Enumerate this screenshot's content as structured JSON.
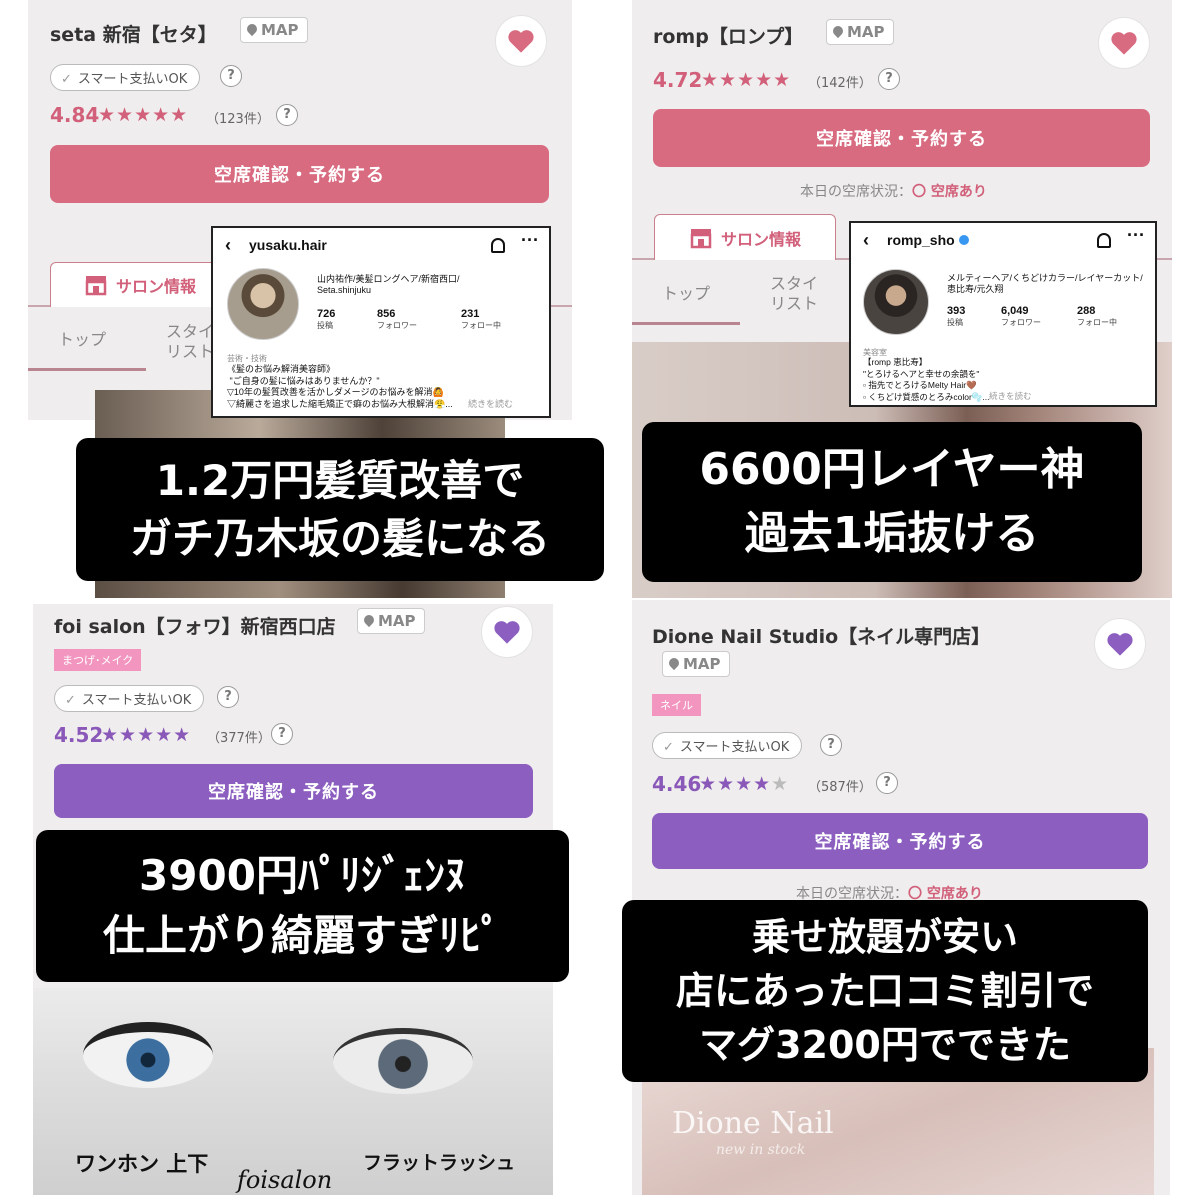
{
  "panels": [
    {
      "salon_name": "seta 新宿【セタ】",
      "map_label": "MAP",
      "payment_badge": "スマート支払いOK",
      "rating": "4.84",
      "stars": "★★★★★",
      "review_count": "（123件）",
      "help": "?",
      "book_button": "空席確認・予約する",
      "tab_active": "サロン情報",
      "tab_top": "トップ",
      "tab_style": "スタイ\nリスト",
      "instagram": {
        "handle": "yusaku.hair",
        "bio_head": "山内祐作/美髪ロングヘア/新宿西口/\nSeta.shinjuku",
        "posts": "726",
        "posts_label": "投稿",
        "followers": "856",
        "followers_label": "フォロワー",
        "following": "231",
        "following_label": "フォロー中",
        "category": "芸術・技術",
        "bio": "《髪のお悩み解消美容師》\n \"ご自身の髪に悩みはありませんか？\"\n▽10年の髪質改善を活かしダメージのお悩みを解消🙆\n▽綺麗さを追求した縮毛矯正で癖のお悩み大根解消😤...",
        "more": "続きを読む"
      },
      "caption_line1": "1.2万円髪質改善で",
      "caption_line2": "ガチ乃木坂の髪になる"
    },
    {
      "salon_name": "romp【ロンプ】",
      "map_label": "MAP",
      "rating": "4.72",
      "stars": "★★★★★",
      "review_count": "（142件）",
      "help": "?",
      "book_button": "空席確認・予約する",
      "status_label": "本日の空席状況：",
      "status_value": "〇 空席あり",
      "tab_active": "サロン情報",
      "tab_top": "トップ",
      "tab_style": "スタイ\nリスト",
      "instagram": {
        "handle": "romp_sho",
        "bio_head": "メルティーヘア/くちどけカラー/レイヤーカット/\n恵比寿/元久翔",
        "posts": "393",
        "posts_label": "投稿",
        "followers": "6,049",
        "followers_label": "フォロワー",
        "following": "288",
        "following_label": "フォロー中",
        "category": "美容室",
        "bio": "【romp 恵比寿】\n\"とろけるヘアと幸せの余韻を\"\n▫ 指先でとろけるMelty Hair🤎\n▫ くちどけ質感のとろみcolor🫧...",
        "more": "続きを読む"
      },
      "caption_line1": "6600円レイヤー神",
      "caption_line2": "過去1垢抜ける"
    },
    {
      "salon_name": "foi salon【フォワ】新宿西口店",
      "map_label": "MAP",
      "category_badge": "まつげ･メイク",
      "payment_badge": "スマート支払いOK",
      "rating": "4.52",
      "stars": "★★★★★",
      "review_count": "（377件）",
      "help": "?",
      "book_button": "空席確認・予約する",
      "photo_text_left": "ワンホン 上下",
      "photo_text_center": "foisalon",
      "photo_text_right": "フラットラッシュ",
      "caption_line1": "3900円ﾊﾟﾘｼﾞｪﾝﾇ",
      "caption_line2": "仕上がり綺麗すぎﾘﾋﾟ"
    },
    {
      "salon_name": "Dione Nail Studio【ネイル専門店】",
      "map_label": "MAP",
      "category_badge": "ネイル",
      "payment_badge": "スマート支払いOK",
      "rating": "4.46",
      "stars": "★★★★★",
      "review_count": "（587件）",
      "help": "?",
      "book_button": "空席確認・予約する",
      "status_label": "本日の空席状況：",
      "status_value": "〇 空席あり",
      "photo_text": "Dione Nail",
      "photo_subtext": "new in stock",
      "caption_line1": "乗せ放題が安い",
      "caption_line2": "店にあった口コミ割引で",
      "caption_line3": "マグ3200円でできた"
    }
  ],
  "colors": {
    "pink": "#d86b80",
    "purple": "#8b5ec0",
    "panel_bg": "#efeded",
    "caption_bg": "#000000"
  }
}
